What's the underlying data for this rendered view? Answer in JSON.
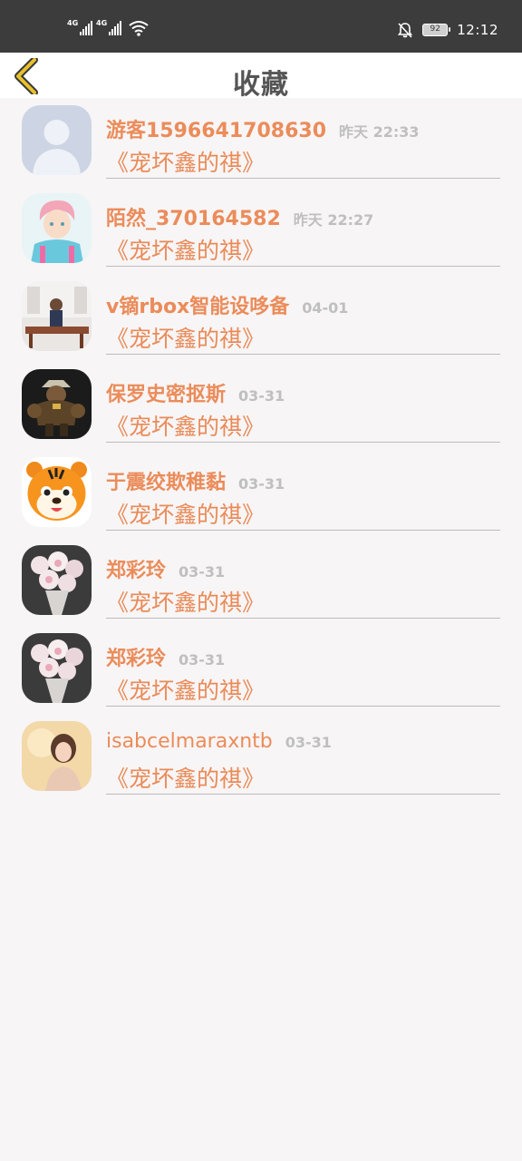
{
  "status_bar": {
    "network_1": "4G",
    "network_2": "4G",
    "battery": "92",
    "time": "12:12"
  },
  "header": {
    "title": "收藏"
  },
  "items": [
    {
      "name": "游客1596641708630",
      "time": "昨天 22:33",
      "title": "《宠坏鑫的祺》",
      "avatar": "default-person"
    },
    {
      "name": "陌然_370164582",
      "time": "昨天 22:27",
      "title": "《宠坏鑫的祺》",
      "avatar": "anime-boy"
    },
    {
      "name": "v镝rbox智能设哆备",
      "time": "04-01",
      "title": "《宠坏鑫的祺》",
      "avatar": "room-photo"
    },
    {
      "name": "保罗史密抠斯",
      "time": "03-31",
      "title": "《宠坏鑫的祺》",
      "avatar": "game-character"
    },
    {
      "name": "于震绞欺稚黏",
      "time": "03-31",
      "title": "《宠坏鑫的祺》",
      "avatar": "tiger"
    },
    {
      "name": "郑彩玲",
      "time": "03-31",
      "title": "《宠坏鑫的祺》",
      "avatar": "flowers"
    },
    {
      "name": "郑彩玲",
      "time": "03-31",
      "title": "《宠坏鑫的祺》",
      "avatar": "flowers"
    },
    {
      "name": "isabcelmaraxntb",
      "time": "03-31",
      "title": "《宠坏鑫的祺》",
      "avatar": "girl-photo"
    }
  ],
  "colors": {
    "accent": "#eb8c5a",
    "status_bar_bg": "#3c3c3c",
    "back_arrow": "#e8c12c",
    "time_text": "#bfbfbf"
  }
}
